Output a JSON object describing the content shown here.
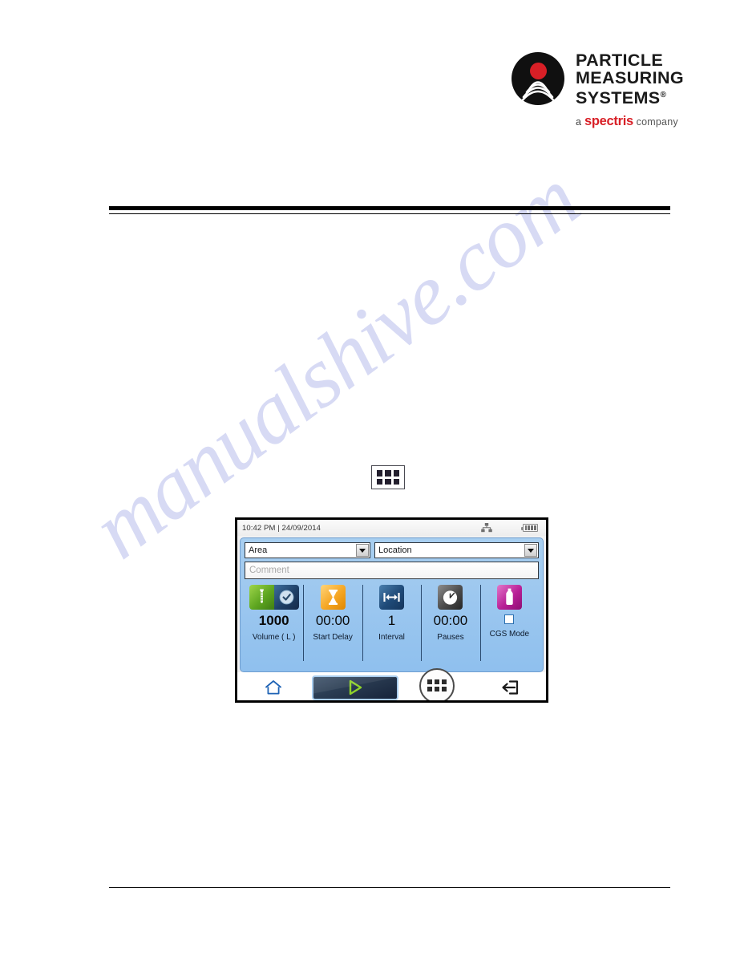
{
  "watermark": {
    "text": "manualshive.com"
  },
  "logo": {
    "line1": "PARTICLE",
    "line2": "MEASURING",
    "line3": "SYSTEMS",
    "registered": "®",
    "tagline_a": "a",
    "tagline_brand": "spectris",
    "tagline_company": "company",
    "mark_name": "particle-measuring-systems-logo"
  },
  "standalone_icon": {
    "name": "apps-grid-icon"
  },
  "device": {
    "statusbar": {
      "time": "10:42 PM | 24/09/2014",
      "network_icon": "network-icon",
      "battery_icon": "battery-icon"
    },
    "selects": [
      {
        "name": "area-dropdown",
        "value": "Area"
      },
      {
        "name": "location-dropdown",
        "value": "Location"
      }
    ],
    "comment": {
      "placeholder": "Comment",
      "value": ""
    },
    "tiles": [
      {
        "icon": "test-tube-icon",
        "icon2": "clock-check-icon",
        "value": "1000",
        "label": "Volume ( L )"
      },
      {
        "icon": "hourglass-icon",
        "value": "00:00",
        "label": "Start Delay"
      },
      {
        "icon": "interval-arrows-icon",
        "value": "1",
        "label": "Interval"
      },
      {
        "icon": "stopwatch-icon",
        "value": "00:00",
        "label": "Pauses"
      },
      {
        "icon": "bottle-icon",
        "value": "",
        "label": "CGS Mode",
        "checkbox": true,
        "checked": false
      }
    ],
    "nav": [
      {
        "name": "home-button",
        "icon": "home-icon"
      },
      {
        "name": "start-button",
        "icon": "play-icon"
      },
      {
        "name": "apps-button",
        "icon": "apps-grid-icon",
        "highlighted": true
      },
      {
        "name": "exit-button",
        "icon": "exit-icon"
      }
    ]
  },
  "colors": {
    "brand_red": "#d81f26",
    "panel_blue": "#9cc7ef",
    "play_green": "#8fd22a",
    "tile_green": "#5ea620",
    "tile_orange": "#f5a623",
    "tile_magenta": "#b81f96"
  }
}
